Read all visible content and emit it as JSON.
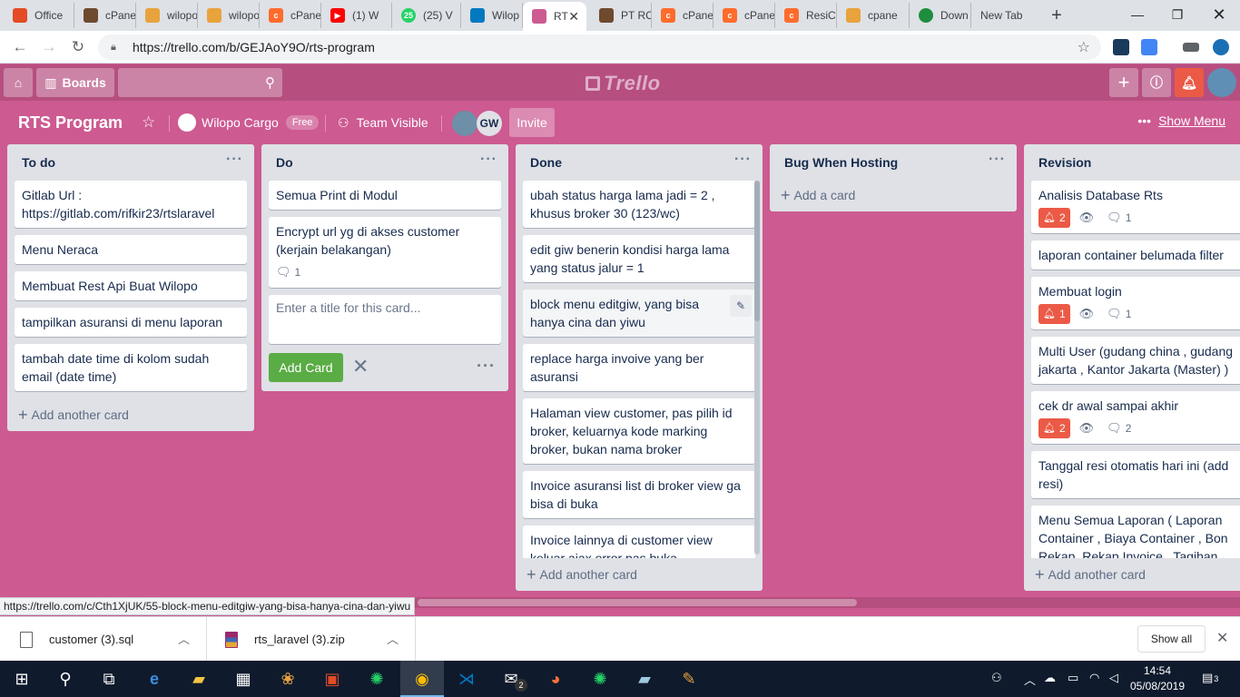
{
  "browser": {
    "tabs": [
      {
        "title": "Office",
        "color": "#e34c26"
      },
      {
        "title": "cPane",
        "color": "#6e4a2e"
      },
      {
        "title": "wilopo",
        "color": "#e8a33d"
      },
      {
        "title": "wilopo",
        "color": "#e8a33d"
      },
      {
        "title": "cPane",
        "color": "#ff6c2c"
      },
      {
        "title": "(1) W",
        "color": "#ff0000"
      },
      {
        "title": "(25) V",
        "color": "#25d366"
      },
      {
        "title": "Wilop",
        "color": "#0079bf"
      },
      {
        "title": "RT",
        "color": "#cd5a91"
      },
      {
        "title": "PT RC",
        "color": "#6e4a2e"
      },
      {
        "title": "cPane",
        "color": "#ff6c2c"
      },
      {
        "title": "cPane",
        "color": "#ff6c2c"
      },
      {
        "title": "ResiC",
        "color": "#ff6c2c"
      },
      {
        "title": "cpane",
        "color": "#e8a33d"
      },
      {
        "title": "Down",
        "color": "#1e8e3e"
      },
      {
        "title": "New Tab",
        "color": ""
      }
    ],
    "url": "https://trello.com/b/GEJAoY9O/rts-program",
    "status_url": "https://trello.com/c/Cth1XjUK/55-block-menu-editgiw-yang-bisa-hanya-cina-dan-yiwu"
  },
  "trello_header": {
    "boards_label": "Boards",
    "logo_text": "Trello"
  },
  "board": {
    "title": "RTS Program",
    "team": "Wilopo Cargo",
    "team_badge": "Free",
    "visibility": "Team Visible",
    "member_initials": "GW",
    "invite_label": "Invite",
    "show_menu_label": "Show Menu"
  },
  "lists": [
    {
      "title": "To do",
      "cards": [
        {
          "text": "Gitlab Url : https://gitlab.com/rifkir23/rtslaravel"
        },
        {
          "text": "Menu Neraca"
        },
        {
          "text": "Membuat Rest Api Buat Wilopo"
        },
        {
          "text": "tampilkan asuransi di menu laporan"
        },
        {
          "text": "tambah date time di kolom sudah email (date time)"
        }
      ],
      "add_label": "Add another card"
    },
    {
      "title": "Do",
      "cards": [
        {
          "text": "Semua Print di Modul"
        },
        {
          "text": "Encrypt url yg di akses customer (kerjain belakangan)",
          "comments": "1"
        }
      ],
      "composer_placeholder": "Enter a title for this card...",
      "composer_add": "Add Card"
    },
    {
      "title": "Done",
      "cards": [
        {
          "text": "ubah status harga lama jadi = 2 , khusus broker 30 (123/wc)"
        },
        {
          "text": "edit giw benerin kondisi harga lama yang status jalur = 1"
        },
        {
          "text": "block menu editgiw, yang bisa hanya cina dan yiwu"
        },
        {
          "text": "replace harga invoive yang ber asuransi"
        },
        {
          "text": "Halaman view customer, pas pilih id broker, keluarnya kode marking broker, bukan nama broker"
        },
        {
          "text": "Invoice asuransi list di broker view ga bisa di buka"
        },
        {
          "text": "Invoice lainnya di customer view keluar ajax error pas buka"
        }
      ],
      "add_label": "Add another card"
    },
    {
      "title": "Bug When Hosting",
      "cards": [],
      "add_label": "Add a card"
    },
    {
      "title": "Revision",
      "cards": [
        {
          "text": "Analisis Database Rts",
          "due": "2",
          "comments": "1"
        },
        {
          "text": "laporan container belumada filter"
        },
        {
          "text": "Membuat login",
          "due": "1",
          "comments": "1"
        },
        {
          "text": "Multi User (gudang china , gudang jakarta , Kantor Jakarta (Master) )"
        },
        {
          "text": "cek dr awal sampai akhir",
          "due": "2",
          "comments": "2"
        },
        {
          "text": "Tanggal resi otomatis hari ini (add resi)"
        },
        {
          "text": "Menu Semua Laporan ( Laporan Container , Biaya Container , Bon Rekap, Rekap Invoice , Tagihan"
        }
      ],
      "add_label": "Add another card"
    }
  ],
  "downloads": [
    {
      "name": "customer (3).sql"
    },
    {
      "name": "rts_laravel (3).zip"
    }
  ],
  "downloads_show_all": "Show all",
  "taskbar": {
    "time": "14:54",
    "date": "05/08/2019",
    "notifications": "3",
    "mail_count": "2"
  }
}
